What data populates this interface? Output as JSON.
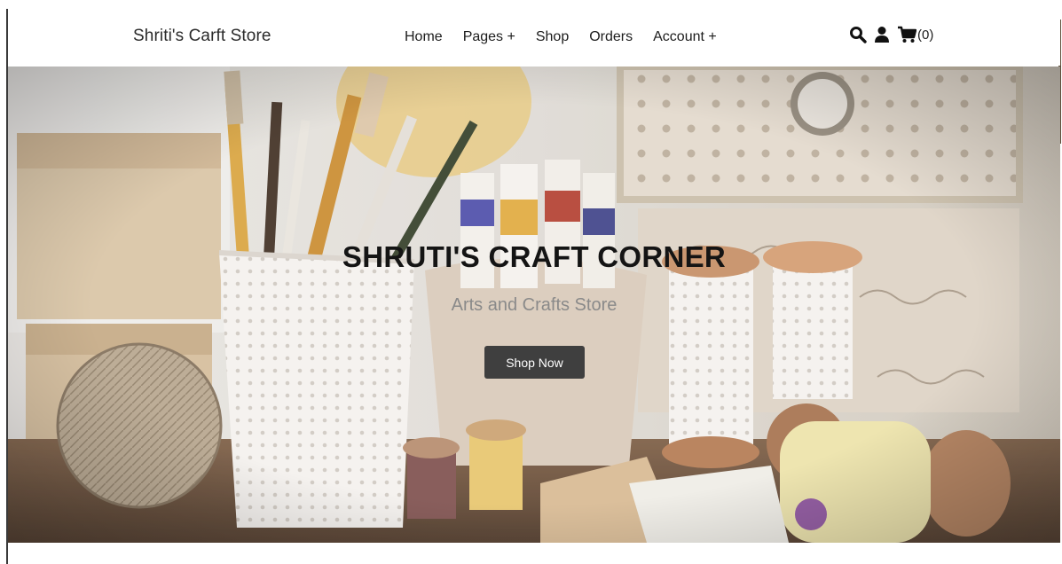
{
  "brand": {
    "name": "Shriti's Carft Store"
  },
  "nav": {
    "items": [
      {
        "label": "Home"
      },
      {
        "label": "Pages +"
      },
      {
        "label": "Shop"
      },
      {
        "label": "Orders"
      },
      {
        "label": "Account +"
      }
    ]
  },
  "icons": {
    "search": "search-icon",
    "account": "user-icon",
    "cart": "cart-icon",
    "cart_count": "(0)"
  },
  "hero": {
    "title": "SHRUTI'S CRAFT CORNER",
    "subtitle": "Arts and Crafts Store",
    "cta_label": "Shop Now"
  },
  "colors": {
    "button_bg": "#3f3f3f",
    "title_text": "#141414",
    "subtitle_text": "#8a8a8a"
  }
}
